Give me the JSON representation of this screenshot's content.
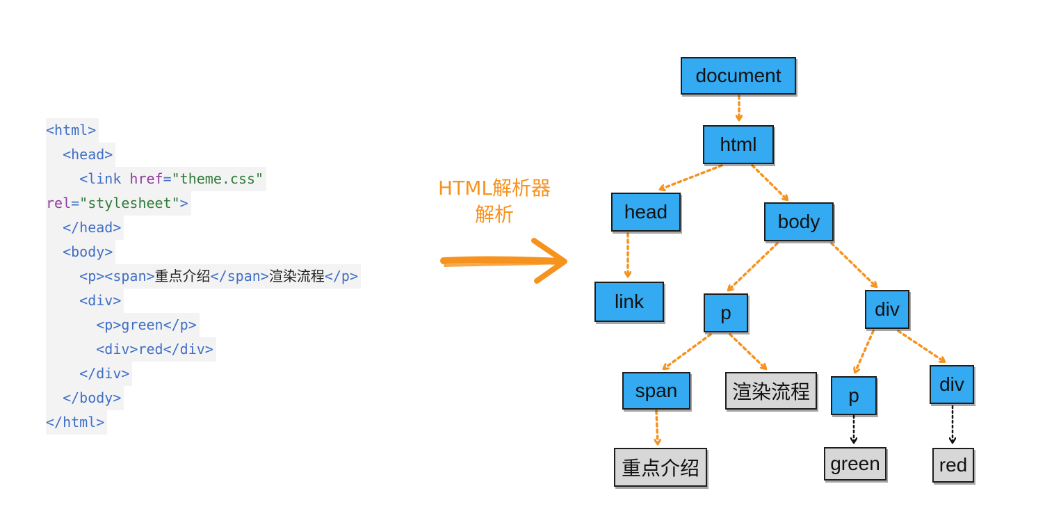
{
  "code": {
    "lines": [
      [
        {
          "t": "tag",
          "v": "<html>"
        }
      ],
      [
        {
          "t": "tag",
          "v": "  <head>"
        }
      ],
      [
        {
          "t": "tag",
          "v": "    <link "
        },
        {
          "t": "attr",
          "v": "href"
        },
        {
          "t": "tag",
          "v": "="
        },
        {
          "t": "str",
          "v": "\"theme.css\""
        }
      ],
      [
        {
          "t": "attr",
          "v": "rel"
        },
        {
          "t": "tag",
          "v": "="
        },
        {
          "t": "str",
          "v": "\"stylesheet\""
        },
        {
          "t": "tag",
          "v": ">"
        }
      ],
      [
        {
          "t": "tag",
          "v": "  </head>"
        }
      ],
      [
        {
          "t": "tag",
          "v": "  <body>"
        }
      ],
      [
        {
          "t": "tag",
          "v": "    <p><span>"
        },
        {
          "t": "txt",
          "v": "重点介绍"
        },
        {
          "t": "tag",
          "v": "</span>"
        },
        {
          "t": "txt",
          "v": "渲染流程"
        },
        {
          "t": "tag",
          "v": "</p>"
        }
      ],
      [
        {
          "t": "tag",
          "v": "    <div>"
        }
      ],
      [
        {
          "t": "tag",
          "v": "      <p>green</p>"
        }
      ],
      [
        {
          "t": "tag",
          "v": "      <div>red</div>"
        }
      ],
      [
        {
          "t": "tag",
          "v": "    </div>"
        }
      ],
      [
        {
          "t": "tag",
          "v": "  </body>"
        }
      ],
      [
        {
          "t": "tag",
          "v": "</html>"
        }
      ]
    ]
  },
  "parser": {
    "line1": "HTML解析器",
    "line2": "解析"
  },
  "tree": {
    "document": "document",
    "html": "html",
    "head": "head",
    "body": "body",
    "link": "link",
    "p": "p",
    "div": "div",
    "span": "span",
    "render_text": "渲染流程",
    "p2": "p",
    "div2": "div",
    "highlight_text": "重点介绍",
    "green": "green",
    "red": "red"
  },
  "colors": {
    "element_fill": "#33aaf1",
    "text_fill": "#d7d7d7",
    "arrow_orange": "#f6921e",
    "arrow_black": "#111111"
  }
}
